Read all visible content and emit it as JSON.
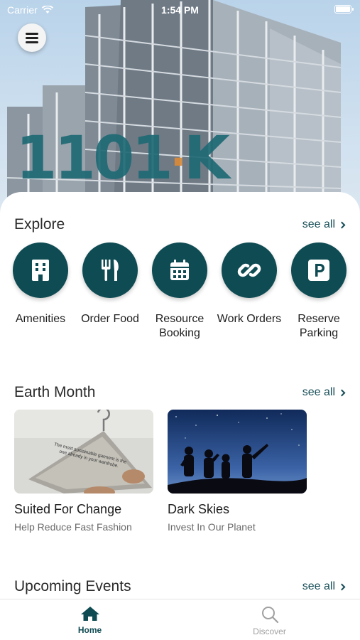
{
  "status_bar": {
    "carrier": "Carrier",
    "time": "1:54 PM"
  },
  "hero": {
    "logo_text": "1101",
    "logo_suffix": "K"
  },
  "explore": {
    "title": "Explore",
    "see_all": "see all",
    "items": [
      {
        "label": "Amenities",
        "icon": "building-icon"
      },
      {
        "label": "Order Food",
        "icon": "utensils-icon"
      },
      {
        "label": "Resource Booking",
        "icon": "calendar-icon"
      },
      {
        "label": "Work Orders",
        "icon": "link-icon"
      },
      {
        "label": "Reserve Parking",
        "icon": "parking-icon"
      }
    ]
  },
  "earth_month": {
    "title": "Earth Month",
    "see_all": "see all",
    "cards": [
      {
        "title": "Suited For Change",
        "subtitle": "Help Reduce Fast Fashion",
        "image_caption": "The most sustainable garment is the one already in your wardrobe."
      },
      {
        "title": "Dark Skies",
        "subtitle": "Invest In Our Planet"
      }
    ]
  },
  "upcoming_events": {
    "title": "Upcoming Events",
    "see_all": "see all"
  },
  "tabbar": {
    "home": "Home",
    "discover": "Discover"
  },
  "colors": {
    "accent": "#0f4b53",
    "logo": "#1f6a75",
    "logo_dot": "#d98a3a"
  }
}
